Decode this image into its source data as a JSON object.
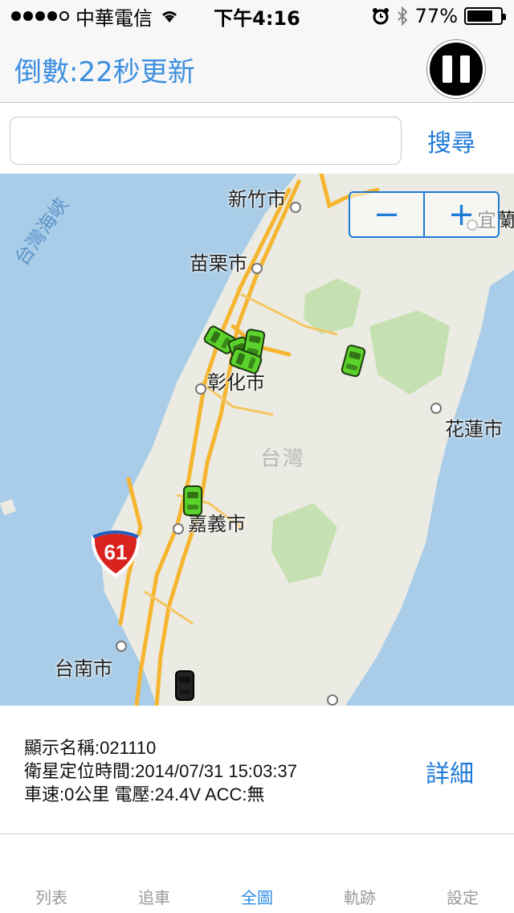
{
  "status_bar": {
    "carrier": "中華電信",
    "time": "下午4:16",
    "battery": "77%",
    "battery_level": 0.77,
    "icons": [
      "signal-dots",
      "wifi-icon",
      "alarm-icon",
      "bluetooth-icon",
      "battery-icon"
    ]
  },
  "nav": {
    "countdown": "倒數:22秒更新",
    "pause_icon": "pause-icon"
  },
  "search": {
    "value": "",
    "placeholder": "",
    "button_label": "搜尋"
  },
  "map": {
    "cities": {
      "hsinchu": "新竹市",
      "miaoli": "苗栗市",
      "changhua": "彰化市",
      "chiayi": "嘉義市",
      "tainan": "台南市",
      "hualien": "花蓮市",
      "yilan": "宜蘭"
    },
    "region": "台灣",
    "sea": "台灣海峽",
    "highway": "61",
    "zoom_out": "−",
    "zoom_in": "+"
  },
  "info": {
    "name_line": "顯示名稱:021110",
    "gps_time_line": "衛星定位時間:2014/07/31 15:03:37",
    "speed_line": "車速:0公里 電壓:24.4V ACC:無",
    "detail_label": "詳細"
  },
  "tabs": [
    {
      "label": "列表",
      "active": false
    },
    {
      "label": "追車",
      "active": false
    },
    {
      "label": "全圖",
      "active": true
    },
    {
      "label": "軌跡",
      "active": false
    },
    {
      "label": "設定",
      "active": false
    }
  ],
  "colors": {
    "accent": "#1f7ad6",
    "countdown": "#3d8fe0",
    "land": "#ecebe3",
    "sea": "#a9cde8",
    "road": "#f5b530",
    "forest": "#c5e1b1"
  }
}
